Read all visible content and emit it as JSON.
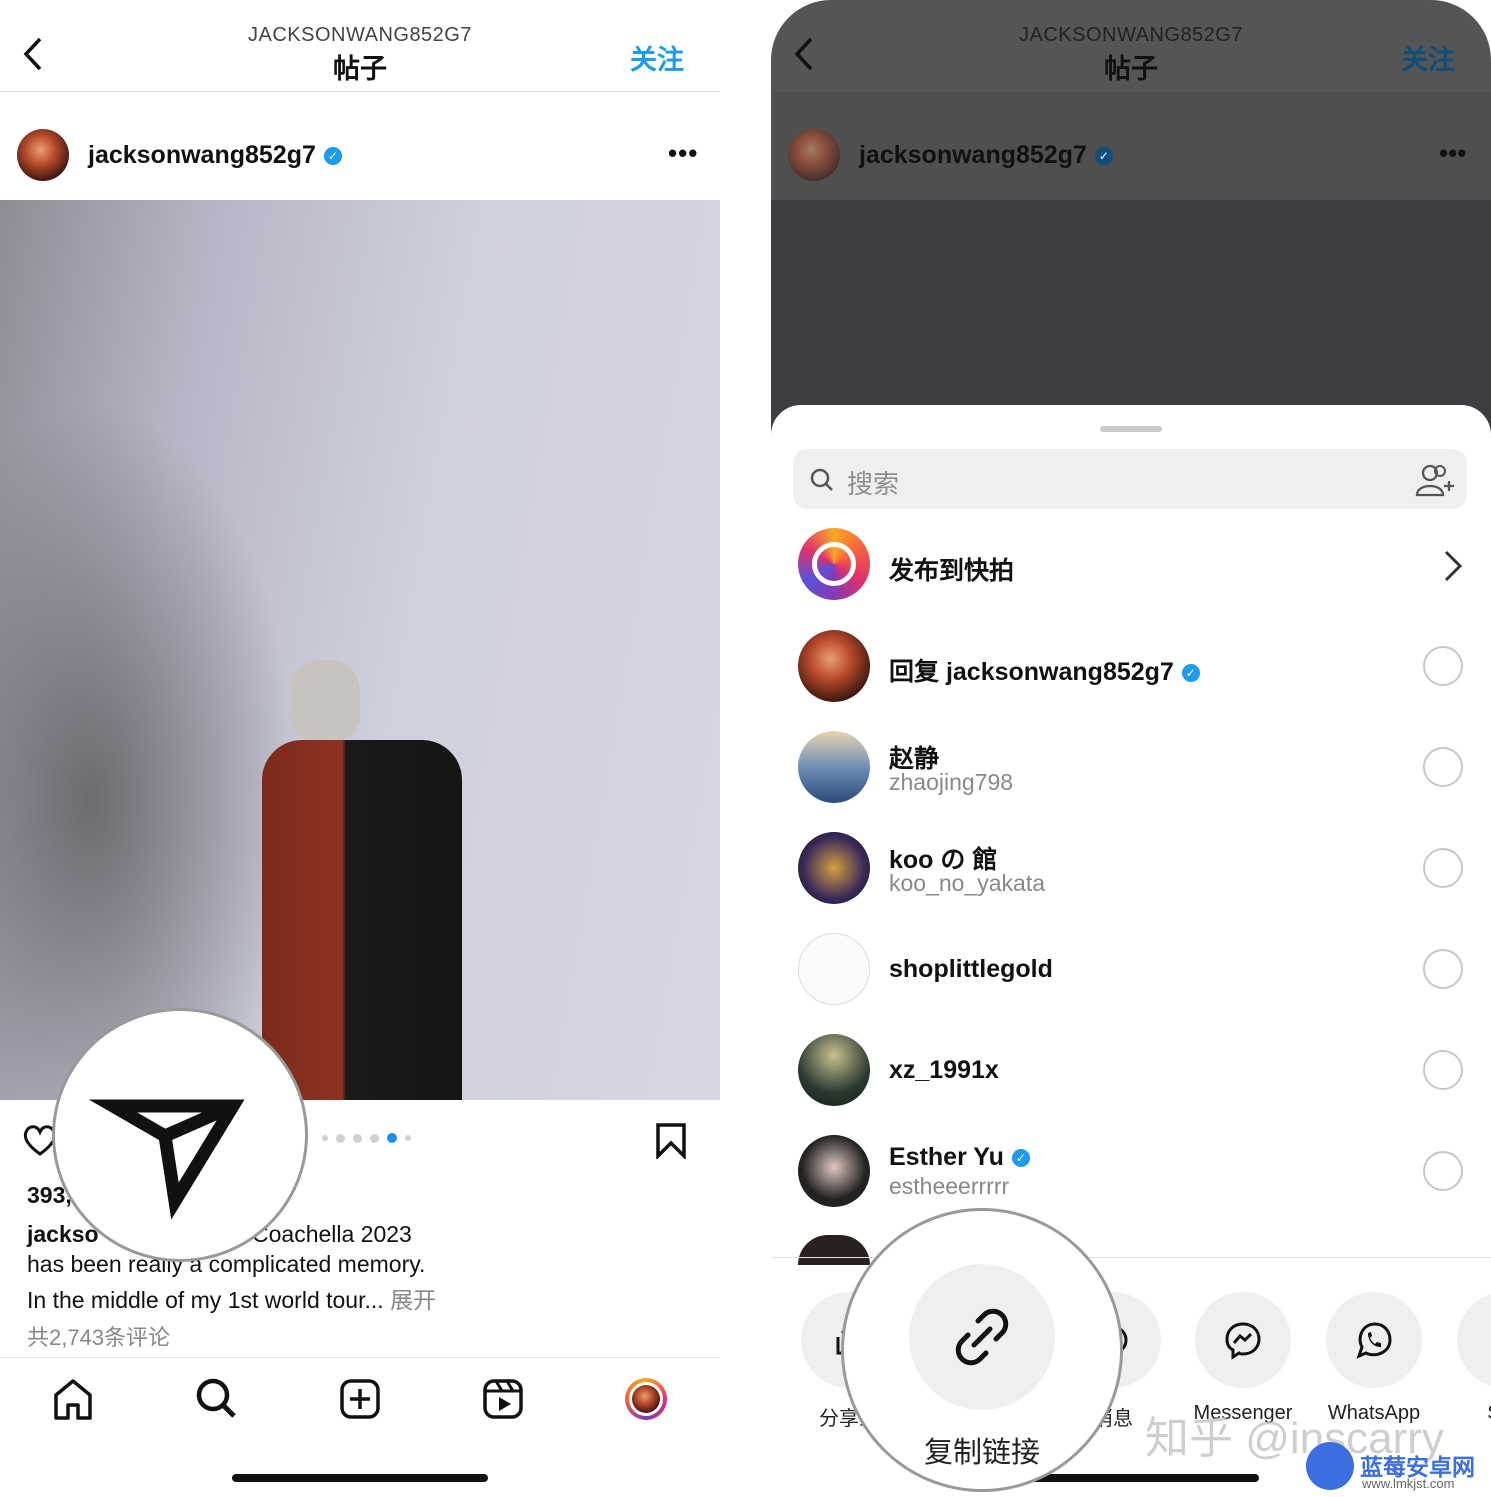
{
  "left": {
    "header": {
      "account": "JACKSONWANG852G7",
      "title": "帖子",
      "follow": "关注"
    },
    "post": {
      "username": "jacksonwang852g7",
      "likes_partial": "393,",
      "caption_line1_start": "jackso",
      "caption_line1_end": "Coachella 2023",
      "caption_line2": "has been really a complicated memory.",
      "caption_line3": "In the middle of my 1st world tour...",
      "expand": "展开",
      "comments": "共2,743条评论",
      "carousel_dots": 6,
      "carousel_active": 5
    },
    "nav": [
      "home-icon",
      "search-icon",
      "create-icon",
      "reels-icon",
      "profile-icon"
    ]
  },
  "right": {
    "header": {
      "account": "JACKSONWANG852G7",
      "title": "帖子",
      "follow": "关注"
    },
    "username": "jacksonwang852g7",
    "sheet": {
      "search_placeholder": "搜索",
      "story": "发布到快拍",
      "contacts": [
        {
          "name": "回复 jacksonwang852g7",
          "verified": true
        },
        {
          "name": "赵静",
          "sub": "zhaojing798"
        },
        {
          "name": "koo の 館",
          "sub": "koo_no_yakata"
        },
        {
          "name": "shoplittlegold"
        },
        {
          "name": "xz_1991x"
        },
        {
          "name": "Esther Yu",
          "sub": "estheeerrrrr",
          "verified": true
        }
      ],
      "share": [
        {
          "label": "分享到",
          "icon": "share-icon"
        },
        {
          "label": "复制链接",
          "icon": "link-icon"
        },
        {
          "label": "消息",
          "icon": "message-icon"
        },
        {
          "label": "Messenger",
          "icon": "messenger-icon"
        },
        {
          "label": "WhatsApp",
          "icon": "whatsapp-icon"
        },
        {
          "label": "Sna",
          "icon": "snapchat-icon"
        }
      ]
    }
  },
  "watermark": {
    "text": "知乎 @inscarry",
    "logo_text": "蓝莓安卓网",
    "logo_url": "www.lmkjst.com"
  },
  "colors": {
    "accent": "#1a9bf0",
    "dot_active": "#1d8ff0"
  }
}
